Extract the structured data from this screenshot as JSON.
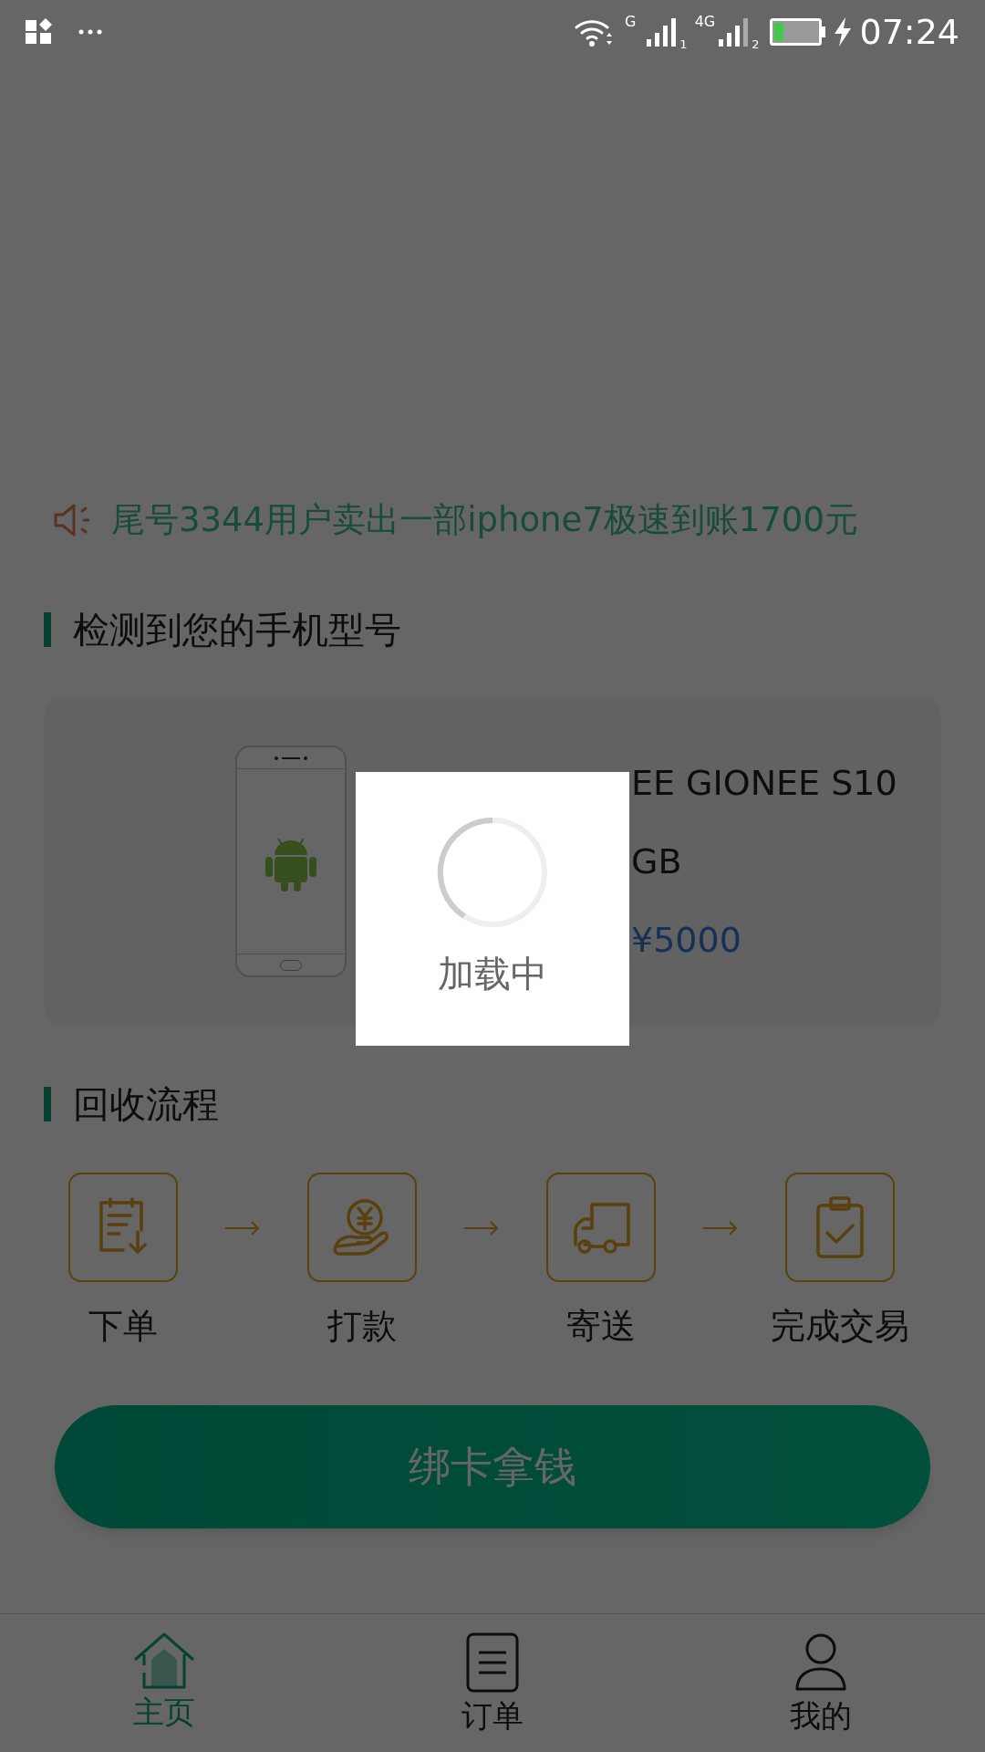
{
  "status_bar": {
    "time": "07:24",
    "sim1": "1",
    "sim2": "2",
    "network1": "G",
    "network2": "4G"
  },
  "ticker": {
    "text": "尾号3344用户卖出一部iphone7极速到账1700元"
  },
  "detected_section": {
    "title": "检测到您的手机型号",
    "model": "EE GIONEE S10",
    "storage": "GB",
    "price": "¥5000"
  },
  "process_section": {
    "title": "回收流程",
    "steps": [
      {
        "kind": "order",
        "label": "下单"
      },
      {
        "kind": "pay",
        "label": "打款"
      },
      {
        "kind": "ship",
        "label": "寄送"
      },
      {
        "kind": "done",
        "label": "完成交易"
      }
    ]
  },
  "primary_button": {
    "label": "绑卡拿钱"
  },
  "loading_dialog": {
    "text": "加载中"
  },
  "tab_bar": [
    {
      "kind": "home",
      "label": "主页",
      "selected": true
    },
    {
      "kind": "orders",
      "label": "订单",
      "selected": false
    },
    {
      "kind": "me",
      "label": "我的",
      "selected": false
    }
  ]
}
